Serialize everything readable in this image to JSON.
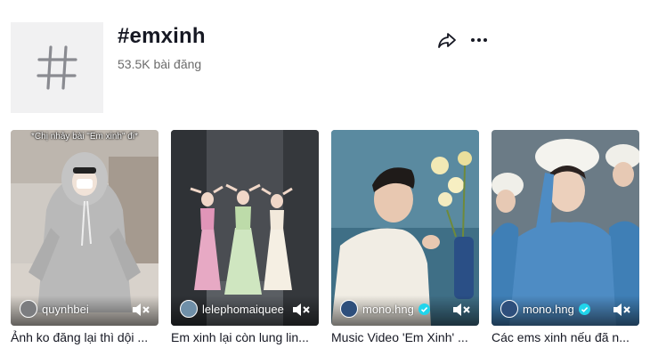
{
  "header": {
    "hashtag_title": "#emxinh",
    "post_count": "53.5K bài đăng",
    "share_icon": "share-icon",
    "more_icon": "more-dots-icon"
  },
  "videos": [
    {
      "overlay_caption": "*Chị nhảy bài \"Em xinh\" đi*",
      "author": "quynhbei",
      "verified": false,
      "description": "Ảnh ko đăng lại thì dội ...",
      "mute_icon": "muted-speaker-icon"
    },
    {
      "overlay_caption": "",
      "author": "lelephomaiquee",
      "verified": false,
      "description": "Em xinh lại còn lung lin...",
      "mute_icon": "muted-speaker-icon"
    },
    {
      "overlay_caption": "",
      "author": "mono.hng",
      "verified": true,
      "description": "Music Video 'Em Xinh' ...",
      "mute_icon": "muted-speaker-icon"
    },
    {
      "overlay_caption": "",
      "author": "mono.hng",
      "verified": true,
      "description": "Các ems xinh nếu đã n...",
      "mute_icon": "muted-speaker-icon"
    }
  ],
  "colors": {
    "text_primary": "#161823",
    "text_secondary": "#6b6b6b",
    "verified": "#20d5ec",
    "avatar_bg": "#f1f1f2"
  }
}
